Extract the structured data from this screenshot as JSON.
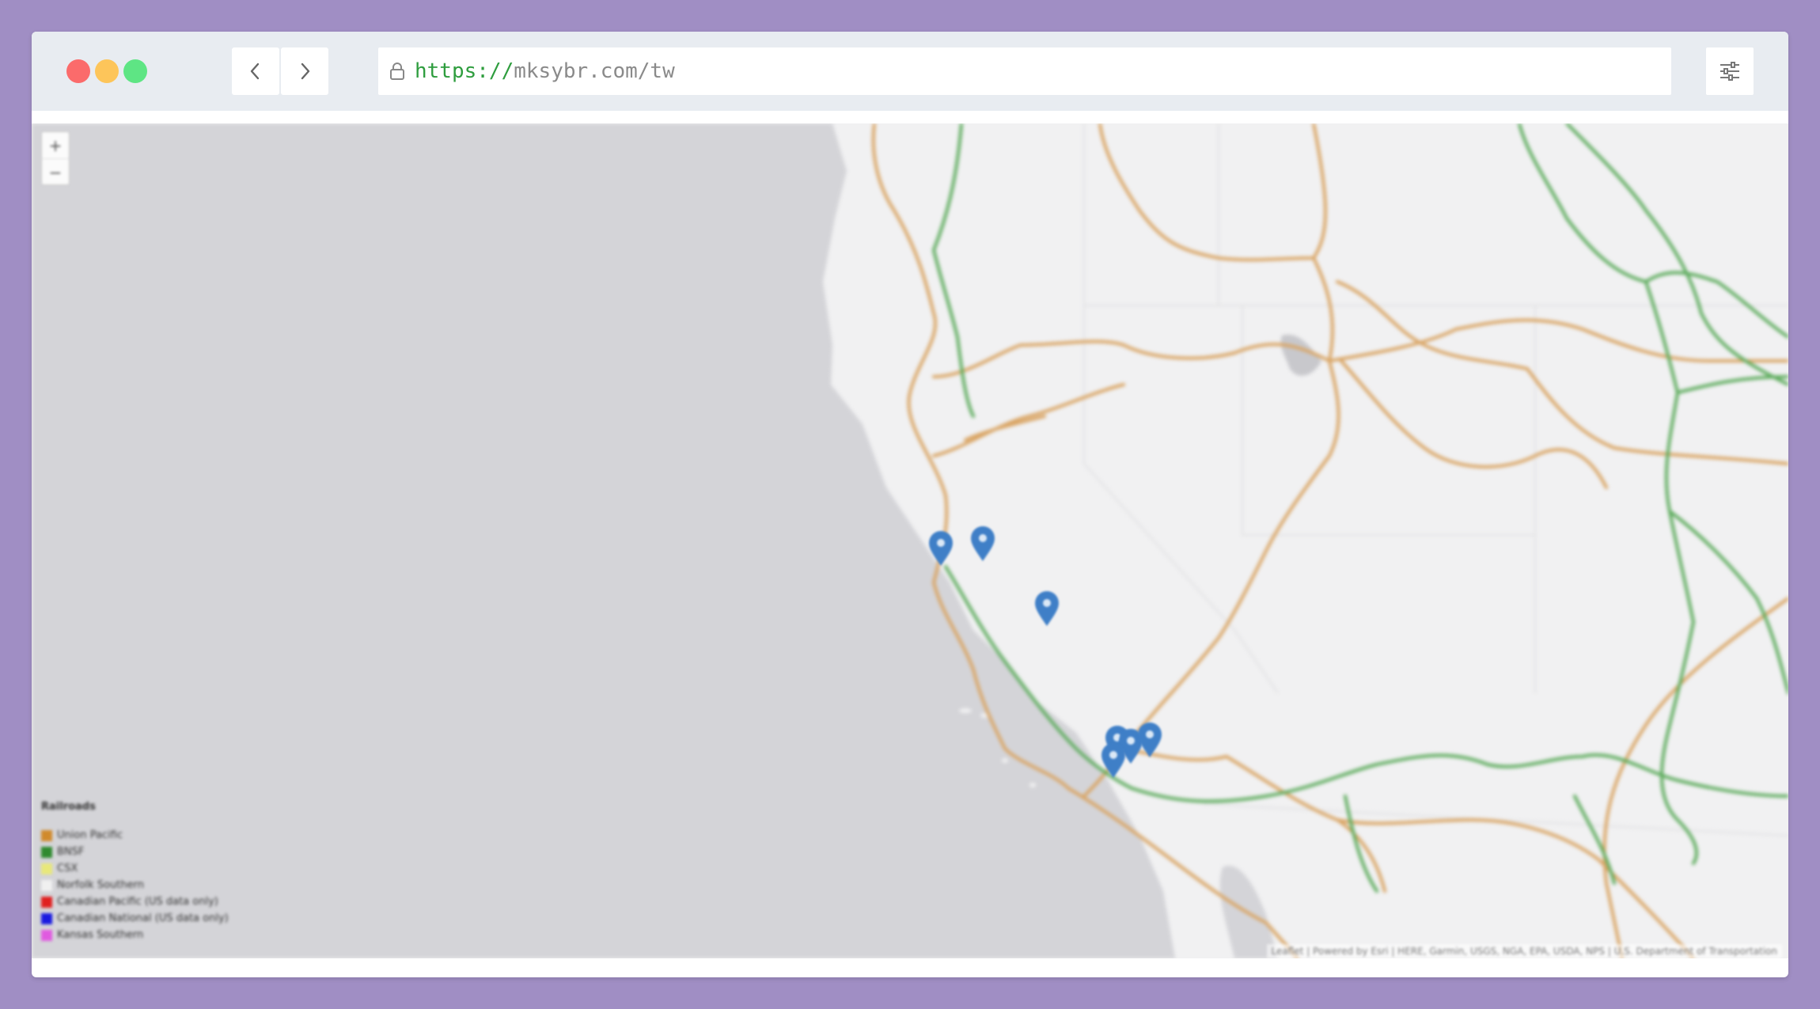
{
  "browser": {
    "url_scheme": "https://",
    "url_host": "mksybr.com/tw",
    "traffic_lights": [
      "#fb6b6b",
      "#fdc55a",
      "#5ee584"
    ],
    "icons": [
      "chevron-left-icon",
      "chevron-right-icon",
      "lock-icon",
      "sliders-icon"
    ]
  },
  "map": {
    "zoom_in": "+",
    "zoom_out": "−",
    "markers": [
      {
        "id": "salinas",
        "icon": "map-pin-icon",
        "color": "#3f7fc7"
      },
      {
        "id": "hollister",
        "icon": "map-pin-icon",
        "color": "#3f7fc7"
      },
      {
        "id": "san-luis-obispo",
        "icon": "map-pin-icon",
        "color": "#3f7fc7"
      },
      {
        "id": "los-angeles-1",
        "icon": "map-pin-icon",
        "color": "#3f7fc7"
      },
      {
        "id": "los-angeles-2",
        "icon": "map-pin-icon",
        "color": "#3f7fc7"
      },
      {
        "id": "los-angeles-3",
        "icon": "map-pin-icon",
        "color": "#3f7fc7"
      },
      {
        "id": "los-angeles-4",
        "icon": "map-pin-icon",
        "color": "#3f7fc7"
      }
    ],
    "colors": {
      "ocean": "#d4d4d8",
      "land": "#f1f1f2",
      "union_pacific": "#d9a463",
      "bnsf": "#5cab5c"
    },
    "legend": {
      "title": "Railroads",
      "items": [
        {
          "label": "Union Pacific",
          "color": "#d08a2c"
        },
        {
          "label": "BNSF",
          "color": "#2f8a2f"
        },
        {
          "label": "CSX",
          "color": "#e8e87a"
        },
        {
          "label": "Norfolk Southern",
          "color": "#f0f0f0"
        },
        {
          "label": "Canadian Pacific (US data only)",
          "color": "#e02020"
        },
        {
          "label": "Canadian National (US data only)",
          "color": "#1a1ae0"
        },
        {
          "label": "Kansas Southern",
          "color": "#e05ae0"
        }
      ]
    },
    "attribution": "Leaflet | Powered by Esri | HERE, Garmin, USGS, NGA, EPA, USDA, NPS | U.S. Department of Transportation"
  }
}
